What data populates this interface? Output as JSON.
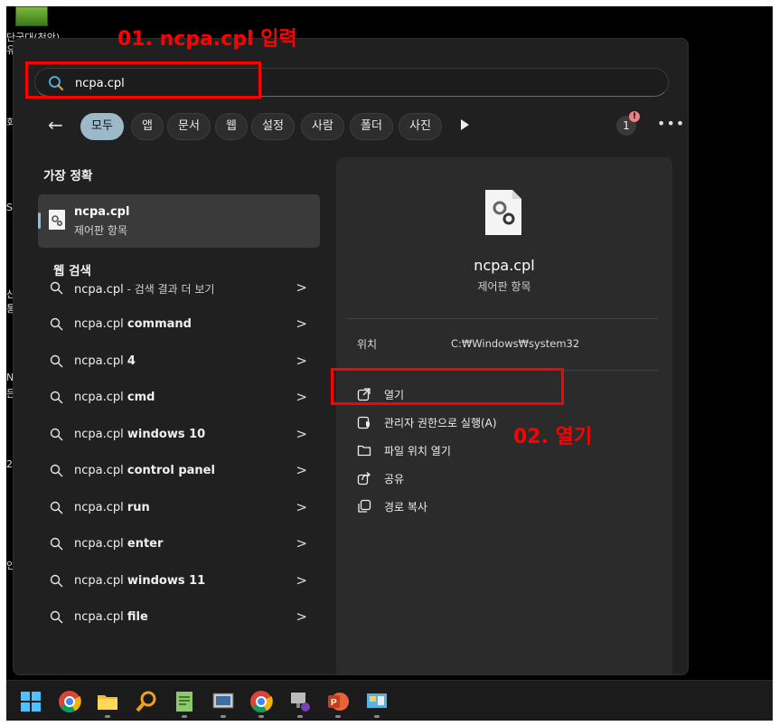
{
  "desktop": {
    "icon_texts": [
      "단국대(천안)",
      "유",
      "회",
      "S",
      "신",
      "통",
      "N",
      "든",
      "2",
      "인"
    ]
  },
  "search": {
    "value": "ncpa.cpl",
    "icon": "search-icon"
  },
  "filters": {
    "back_icon": "back-arrow-icon",
    "chips": [
      "모두",
      "앱",
      "문서",
      "웹",
      "설정",
      "사람",
      "폴더",
      "사진"
    ],
    "active_index": 0,
    "more_icon": "play-icon",
    "notification_count": "1",
    "notification_badge": "!",
    "overflow_icon": "more-icon"
  },
  "best_match": {
    "heading": "가장 정확",
    "name": "ncpa.cpl",
    "subtitle": "제어판 항목"
  },
  "web_search": {
    "heading": "웹 검색",
    "items": [
      {
        "prefix": "ncpa.cpl",
        "bold": "",
        "suffix": " - 검색 결과 더 보기"
      },
      {
        "prefix": "ncpa.cpl ",
        "bold": "command",
        "suffix": ""
      },
      {
        "prefix": "ncpa.cpl ",
        "bold": "4",
        "suffix": ""
      },
      {
        "prefix": "ncpa.cpl ",
        "bold": "cmd",
        "suffix": ""
      },
      {
        "prefix": "ncpa.cpl ",
        "bold": "windows 10",
        "suffix": ""
      },
      {
        "prefix": "ncpa.cpl ",
        "bold": "control panel",
        "suffix": ""
      },
      {
        "prefix": "ncpa.cpl ",
        "bold": "run",
        "suffix": ""
      },
      {
        "prefix": "ncpa.cpl ",
        "bold": "enter",
        "suffix": ""
      },
      {
        "prefix": "ncpa.cpl ",
        "bold": "windows 11",
        "suffix": ""
      },
      {
        "prefix": "ncpa.cpl ",
        "bold": "file",
        "suffix": ""
      }
    ]
  },
  "preview": {
    "title": "ncpa.cpl",
    "subtitle": "제어판 항목",
    "location_label": "위치",
    "location_value": "C:₩Windows₩system32",
    "actions": [
      {
        "label": "열기",
        "icon": "open-external-icon"
      },
      {
        "label": "관리자 권한으로 실행(A)",
        "icon": "admin-shield-icon"
      },
      {
        "label": "파일 위치 열기",
        "icon": "folder-icon"
      },
      {
        "label": "공유",
        "icon": "share-icon"
      },
      {
        "label": "경로 복사",
        "icon": "copy-icon"
      }
    ]
  },
  "annotations": {
    "step1": "01. ncpa.cpl 입력",
    "step2": "02. 열기",
    "color": "#ff0000"
  },
  "taskbar": {
    "items": [
      "windows-start-icon",
      "chrome-icon",
      "file-explorer-icon",
      "search-app-icon",
      "notepad-icon",
      "remote-desktop-icon",
      "chrome-alt-icon",
      "network-app-icon",
      "powerpoint-icon",
      "control-panel-icon"
    ]
  }
}
